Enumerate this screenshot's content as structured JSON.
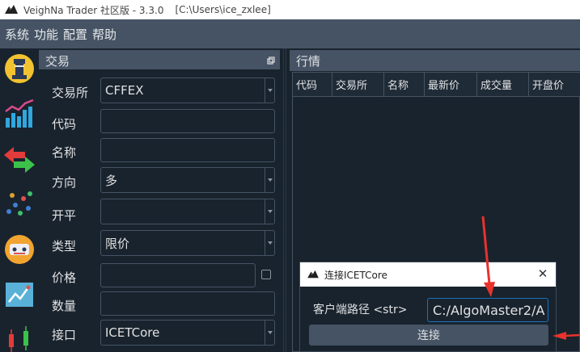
{
  "window": {
    "title": "VeighNa Trader 社区版 - 3.3.0",
    "path": "[C:\\Users\\ice_zxlee]"
  },
  "menu": [
    "系统",
    "功能",
    "配置",
    "帮助"
  ],
  "toolbar_icons": [
    "chess-rook-icon",
    "bar-chart-icon",
    "exchange-arrows-icon",
    "scatter-dots-icon",
    "robot-icon",
    "algo-chart-icon",
    "candlestick-icon"
  ],
  "trade": {
    "title": "交易",
    "fields": [
      {
        "label": "交易所",
        "value": "CFFEX",
        "type": "combo"
      },
      {
        "label": "代码",
        "value": "",
        "type": "input"
      },
      {
        "label": "名称",
        "value": "",
        "type": "input"
      },
      {
        "label": "方向",
        "value": "多",
        "type": "combo"
      },
      {
        "label": "开平",
        "value": "",
        "type": "combo"
      },
      {
        "label": "类型",
        "value": "限价",
        "type": "combo"
      },
      {
        "label": "价格",
        "value": "",
        "type": "input"
      },
      {
        "label": "数量",
        "value": "",
        "type": "input"
      },
      {
        "label": "接口",
        "value": "ICETCore",
        "type": "combo"
      }
    ]
  },
  "market": {
    "title": "行情",
    "columns": [
      "代码",
      "交易所",
      "名称",
      "最新价",
      "成交量",
      "开盘价"
    ]
  },
  "dialog": {
    "title": "连接ICETCore",
    "close": "✕",
    "path_label": "客户端路径 <str>",
    "path_value": "C:/AlgoMaster2/A",
    "connect_label": "连接"
  },
  "colors": {
    "background": "#19232d",
    "panel_header": "#455364",
    "accent_border": "#1a72bb",
    "annotation_arrow": "#e8322c"
  }
}
